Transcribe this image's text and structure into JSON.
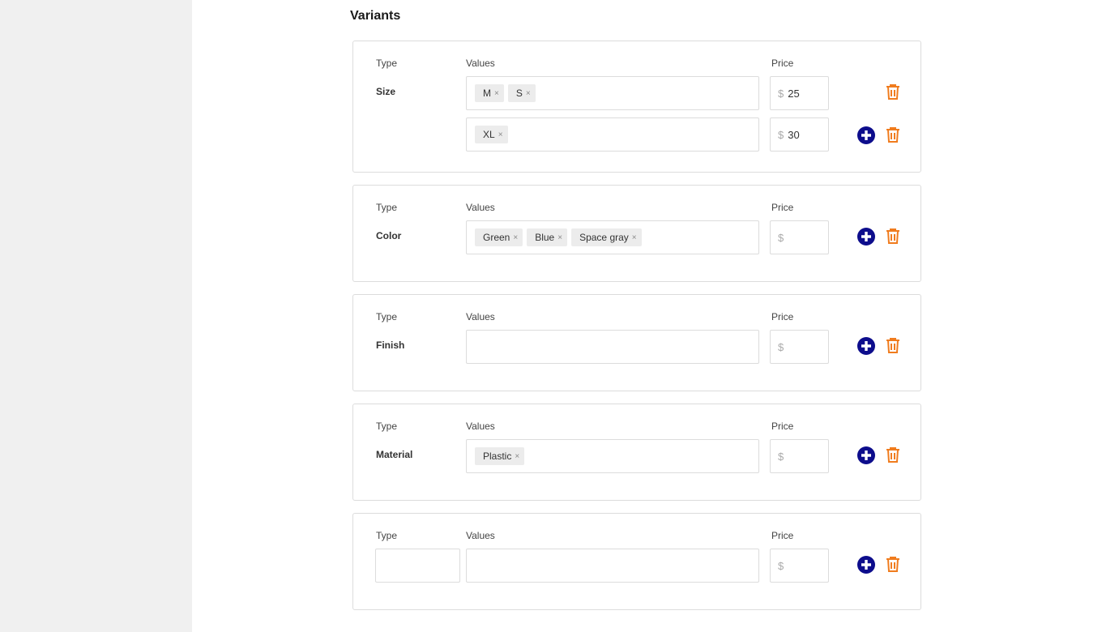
{
  "page": {
    "section_title": "Variants"
  },
  "labels": {
    "type": "Type",
    "values": "Values",
    "price": "Price",
    "currency": "$"
  },
  "colors": {
    "add_icon": "#0d0d8c",
    "delete_icon": "#f07c1e",
    "chip_bg": "#ececec",
    "sidebar_bg": "#f0f0f0"
  },
  "icons": {
    "add": "plus-circle-icon",
    "delete": "trash-icon",
    "chip_remove": "close-icon"
  },
  "variants": [
    {
      "type": "Size",
      "rows": [
        {
          "values": [
            "M",
            "S"
          ],
          "price": "25"
        },
        {
          "values": [
            "XL"
          ],
          "price": "30"
        }
      ]
    },
    {
      "type": "Color",
      "rows": [
        {
          "values": [
            "Green",
            "Blue",
            "Space gray"
          ],
          "price": ""
        }
      ]
    },
    {
      "type": "Finish",
      "rows": [
        {
          "values": [],
          "price": ""
        }
      ]
    },
    {
      "type": "Material",
      "rows": [
        {
          "values": [
            "Plastic"
          ],
          "price": ""
        }
      ]
    },
    {
      "type": "",
      "rows": [
        {
          "values": [],
          "price": ""
        }
      ]
    }
  ]
}
